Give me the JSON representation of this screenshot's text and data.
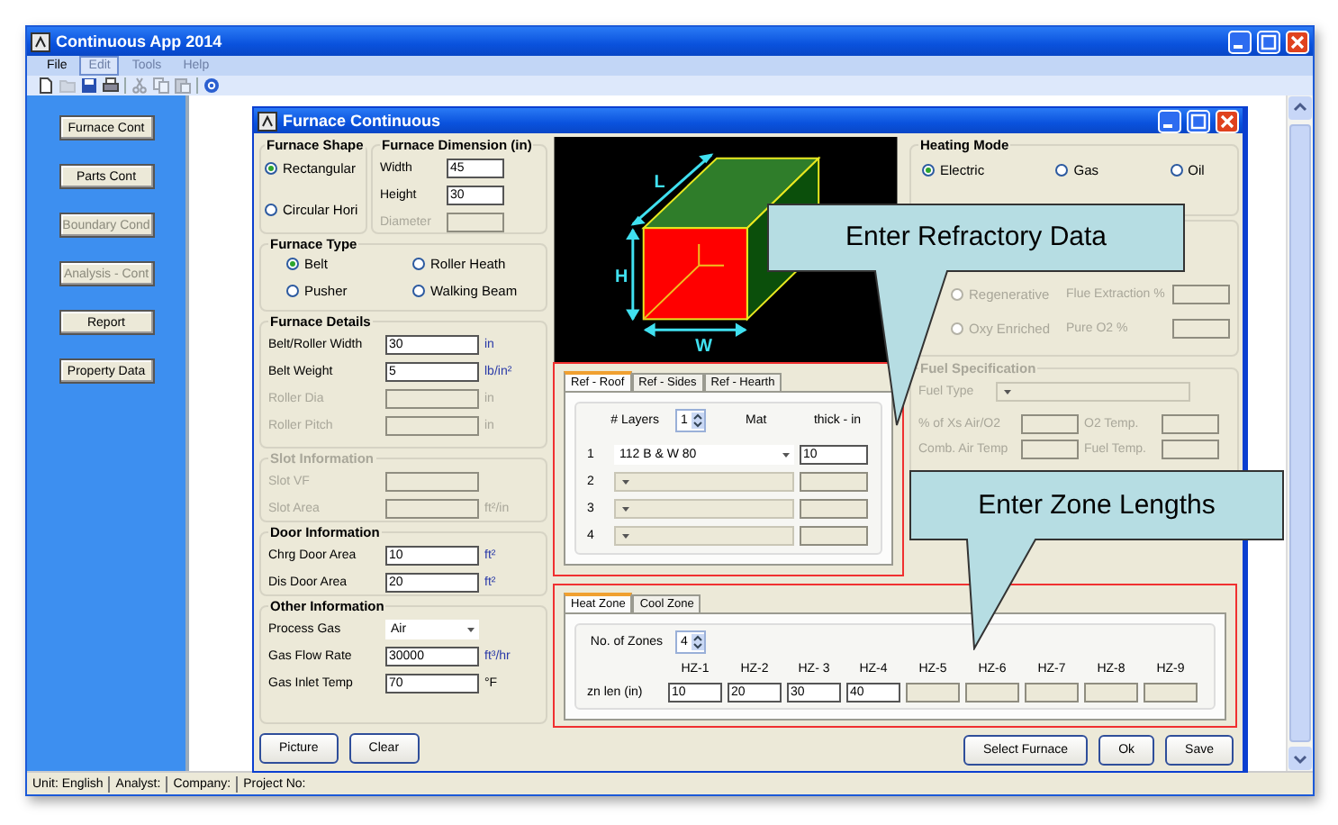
{
  "window": {
    "title": "Continuous App 2014"
  },
  "menu": [
    {
      "label": "File",
      "disabled": false,
      "selected": false
    },
    {
      "label": "Edit",
      "disabled": true,
      "selected": true
    },
    {
      "label": "Tools",
      "disabled": true,
      "selected": false
    },
    {
      "label": "Help",
      "disabled": true,
      "selected": false
    }
  ],
  "toolbar": [
    {
      "kind": "new",
      "disabled": false
    },
    {
      "kind": "open",
      "disabled": true
    },
    {
      "kind": "save",
      "disabled": false
    },
    {
      "kind": "print",
      "disabled": false
    },
    {
      "kind": "separator"
    },
    {
      "kind": "cut",
      "disabled": true
    },
    {
      "kind": "copy",
      "disabled": true
    },
    {
      "kind": "paste",
      "disabled": true
    },
    {
      "kind": "separator"
    },
    {
      "kind": "help",
      "disabled": false
    }
  ],
  "sidebar": [
    {
      "label": "Furnace Cont",
      "disabled": false
    },
    {
      "label": "Parts Cont",
      "disabled": false
    },
    {
      "label": "Boundary Cond",
      "disabled": true
    },
    {
      "label": "Analysis - Cont",
      "disabled": true
    },
    {
      "label": "Report",
      "disabled": false
    },
    {
      "label": "Property Data",
      "disabled": false
    }
  ],
  "child_window": {
    "title": "Furnace Continuous",
    "furnace_shape": {
      "title": "Furnace Shape",
      "options": [
        {
          "label": "Rectangular",
          "selected": true
        },
        {
          "label": "Circular Hori",
          "selected": false
        }
      ]
    },
    "furnace_dimension": {
      "title": "Furnace Dimension (in)",
      "fields": [
        {
          "label": "Width",
          "value": "45",
          "disabled": false
        },
        {
          "label": "Height",
          "value": "30",
          "disabled": false
        },
        {
          "label": "Diameter",
          "disabled": true
        }
      ]
    },
    "furnace_type": {
      "title": "Furnace Type",
      "options": [
        {
          "label": "Belt",
          "selected": true
        },
        {
          "label": "Roller Heath",
          "selected": false
        },
        {
          "label": "Pusher",
          "selected": false
        },
        {
          "label": "Walking Beam",
          "selected": false
        }
      ]
    },
    "furnace_details": {
      "title": "Furnace Details",
      "disabled": false,
      "fields": [
        {
          "label": "Belt/Roller Width",
          "value": "30",
          "unit": "in",
          "disabled": false
        },
        {
          "label": "Belt Weight",
          "value": "5",
          "unit": "lb/in²",
          "disabled": false
        },
        {
          "label": "Roller Dia",
          "unit": "in",
          "disabled": true
        },
        {
          "label": "Roller Pitch",
          "unit": "in",
          "disabled": true
        }
      ]
    },
    "slot_information": {
      "title": "Slot Information",
      "disabled": true,
      "fields": [
        {
          "label": "Slot VF",
          "disabled": true
        },
        {
          "label": "Slot Area",
          "unit": "ft²/in",
          "disabled": true
        }
      ]
    },
    "door_information": {
      "title": "Door Information",
      "disabled": false,
      "fields": [
        {
          "label": "Chrg Door Area",
          "value": "10",
          "unit": "ft²",
          "disabled": false
        },
        {
          "label": "Dis Door Area",
          "value": "20",
          "unit": "ft²",
          "disabled": false
        }
      ]
    },
    "other_information": {
      "title": "Other Information",
      "disabled": false,
      "fields": [
        {
          "kind": "dropdown",
          "label": "Process Gas",
          "value": "Air",
          "disabled": false
        },
        {
          "kind": "text",
          "label": "Gas Flow Rate",
          "value": "30000",
          "unit": "ft³/hr",
          "disabled": false
        },
        {
          "kind": "text",
          "label": "Gas Inlet Temp",
          "value": "70",
          "unit": "°F",
          "disabled": false
        }
      ]
    },
    "diagram": {
      "labels": [
        "L",
        "H",
        "W"
      ]
    },
    "heating_mode": {
      "title": "Heating Mode",
      "options": [
        {
          "label": "Electric",
          "selected": true
        },
        {
          "label": "Gas",
          "selected": false
        },
        {
          "label": "Oil",
          "selected": false
        }
      ]
    },
    "combustion": {
      "disabled": true,
      "options": [
        {
          "label": "Regenerative",
          "selected": false,
          "field_label": "Flue Extraction %"
        },
        {
          "label": "Oxy Enriched",
          "selected": false,
          "field_label": "Pure O2 %"
        }
      ]
    },
    "fuel_specification": {
      "title": "Fuel Specification",
      "disabled": true,
      "fuel_type": "Fuel Type",
      "fields": [
        {
          "label": "% of Xs Air/O2"
        },
        {
          "label": "O2 Temp."
        },
        {
          "label": "Comb. Air Temp"
        },
        {
          "label": "Fuel Temp."
        }
      ]
    },
    "refractory": {
      "tabs": [
        {
          "label": "Ref - Roof",
          "selected": true
        },
        {
          "label": "Ref - Sides",
          "selected": false
        },
        {
          "label": "Ref - Hearth",
          "selected": false
        }
      ],
      "layers_label": "# Layers",
      "layers": "1",
      "mat_label": "Mat",
      "thick_label": "thick - in",
      "rows": [
        {
          "index": "1",
          "material": "112 B & W 80",
          "thickness": "10",
          "disabled": false
        },
        {
          "index": "2",
          "disabled": true
        },
        {
          "index": "3",
          "disabled": true
        },
        {
          "index": "4",
          "disabled": true
        }
      ]
    },
    "zones": {
      "tabs": [
        {
          "label": "Heat Zone",
          "selected": true
        },
        {
          "label": "Cool Zone",
          "selected": false
        }
      ],
      "count_label": "No. of Zones",
      "count": "4",
      "row_label": "zn len (in)",
      "items": [
        {
          "label": "HZ-1",
          "value": "10",
          "disabled": false
        },
        {
          "label": "HZ-2",
          "value": "20",
          "disabled": false
        },
        {
          "label": "HZ- 3",
          "value": "30",
          "disabled": false
        },
        {
          "label": "HZ-4",
          "value": "40",
          "disabled": false
        },
        {
          "label": "HZ-5",
          "disabled": true
        },
        {
          "label": "HZ-6",
          "disabled": true
        },
        {
          "label": "HZ-7",
          "disabled": true
        },
        {
          "label": "HZ-8",
          "disabled": true
        },
        {
          "label": "HZ-9",
          "disabled": true
        }
      ]
    },
    "buttons_left": [
      "Picture",
      "Clear"
    ],
    "buttons_right": [
      "Select Furnace",
      "Ok",
      "Save"
    ]
  },
  "callouts": [
    {
      "text": "Enter Refractory Data"
    },
    {
      "text": "Enter Zone Lengths"
    }
  ],
  "status_bar": [
    "Unit: English",
    "Analyst:",
    "Company:",
    "Project No:"
  ]
}
